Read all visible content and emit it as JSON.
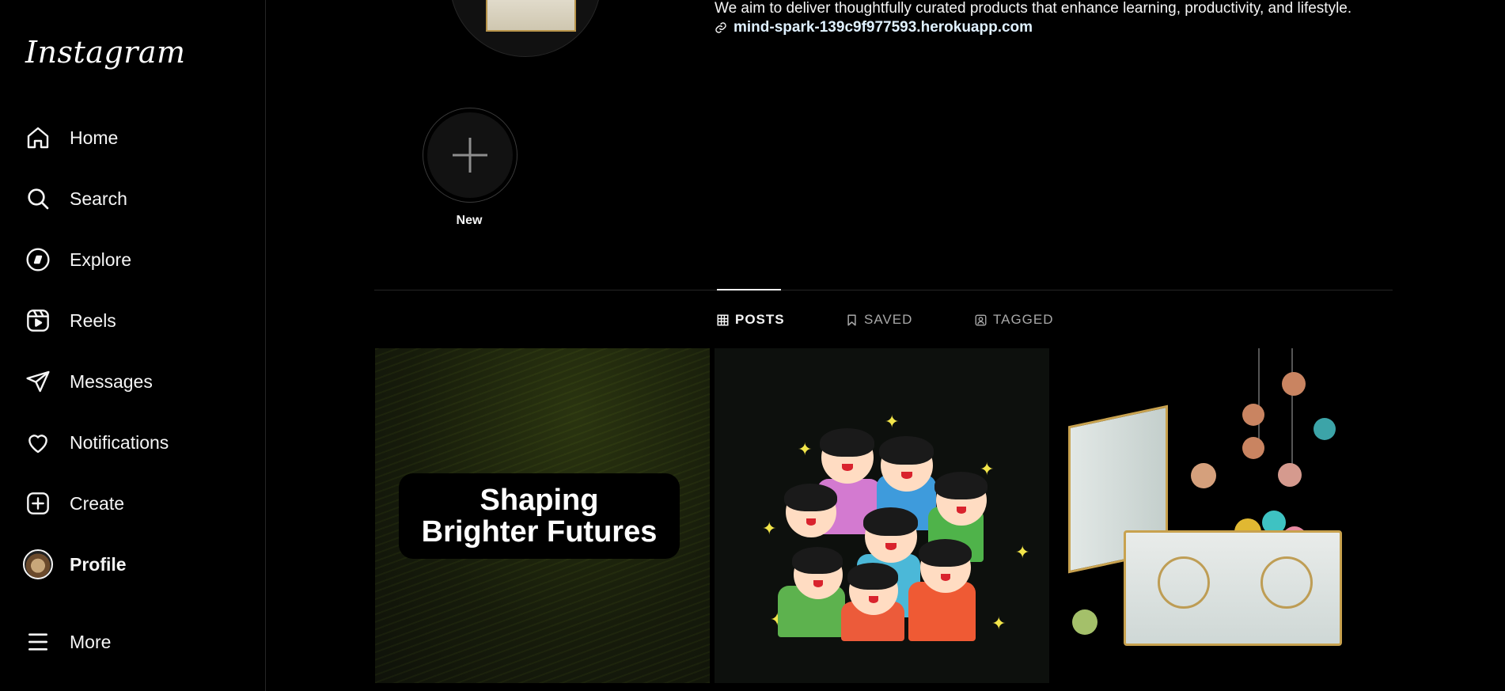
{
  "app": {
    "logo": "Instagram"
  },
  "sidebar": {
    "items": [
      {
        "label": "Home",
        "icon": "home-icon"
      },
      {
        "label": "Search",
        "icon": "search-icon"
      },
      {
        "label": "Explore",
        "icon": "compass-icon"
      },
      {
        "label": "Reels",
        "icon": "reels-icon"
      },
      {
        "label": "Messages",
        "icon": "paper-plane-icon"
      },
      {
        "label": "Notifications",
        "icon": "heart-icon"
      },
      {
        "label": "Create",
        "icon": "plus-square-icon"
      },
      {
        "label": "Profile",
        "icon": "avatar"
      },
      {
        "label": "More",
        "icon": "hamburger-icon"
      }
    ]
  },
  "profile": {
    "bio": "We aim to deliver thoughtfully curated products that enhance learning, productivity, and lifestyle.",
    "link": "mind-spark-139c9f977593.herokuapp.com"
  },
  "highlights": {
    "new_label": "New"
  },
  "tabs": [
    {
      "label": "POSTS",
      "icon": "grid-icon",
      "active": true
    },
    {
      "label": "SAVED",
      "icon": "bookmark-icon",
      "active": false
    },
    {
      "label": "TAGGED",
      "icon": "tagged-icon",
      "active": false
    }
  ],
  "posts": [
    {
      "caption_line1": "Shaping",
      "caption_line2": "Brighter Futures"
    },
    {
      "image": "cartoon-children"
    },
    {
      "image": "treasure-box"
    }
  ]
}
